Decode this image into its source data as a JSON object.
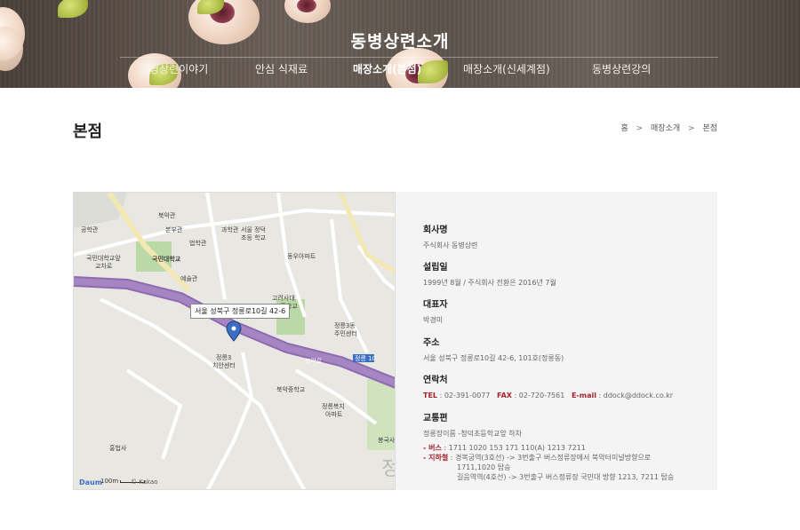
{
  "header": {
    "title": "동병상련소개",
    "nav": [
      {
        "label": "동병상련이야기",
        "active": false
      },
      {
        "label": "안심 식재료",
        "active": false
      },
      {
        "label": "매장소개(본점)",
        "active": true
      },
      {
        "label": "매장소개(신세계점)",
        "active": false
      },
      {
        "label": "동병상련강의",
        "active": false
      }
    ]
  },
  "page": {
    "title": "본점",
    "breadcrumb": [
      "홈",
      ">",
      "매장소개",
      ">",
      "본점"
    ]
  },
  "map": {
    "callout": "서울 성북구 정릉로10길 42-6",
    "labels": {
      "bukakgwan": "북악관",
      "bonbugwan": "본부관",
      "gongakgwan": "공학관",
      "beophakgwan": "법학관",
      "gwahakgwan": "과학관",
      "seoul_jeongdeok": "서울 정덕",
      "school_chodeung": "초등 학교",
      "kookmin_gate": "국민대학교앞",
      "gyochaero": "교차로",
      "kookmin_univ": "국민대학교",
      "yesulgwan": "예술관",
      "dongwoo_apt": "동우아파트",
      "korea_univ_attached": "고려사대",
      "hs": "고등학교",
      "jeongneung3_center": "정릉3동",
      "jumin_center": "주민센터",
      "jeongneung3": "정릉3",
      "chian_center": "치안센터",
      "bukak_middle": "북악중학교",
      "jeongneung_welfare": "정릉복지",
      "apt": "아파트",
      "hongbeopsa": "홍법사",
      "bongguksa": "봉국사",
      "road_label": "북악로",
      "road_sign": "정릉",
      "road_num": "10",
      "big_char": "정"
    },
    "logo": "Daum",
    "scale": "100m",
    "copyright": "© Kakao"
  },
  "info": {
    "company": {
      "label": "회사명",
      "value": "주식회사 동병상련"
    },
    "established": {
      "label": "설립일",
      "value": "1999년 8월 / 주식회사 전환은 2016년 7월"
    },
    "ceo": {
      "label": "대표자",
      "value": "박경미"
    },
    "address": {
      "label": "주소",
      "value": "서울 성북구 정릉로10길 42-6, 101호(정릉동)"
    },
    "contact": {
      "label": "연락처",
      "tel_label": "TEL",
      "tel": " : 02-391-0077",
      "fax_label": "FAX",
      "fax": " : 02-720-7561",
      "email_label": "E-mail",
      "email": " : ddock@ddock.co.kr"
    },
    "transport": {
      "label": "교통편",
      "stop": "정릉장이름 -청덕초등학교앞 하차",
      "bus_prefix": "- ",
      "bus_label": "버스",
      "bus": " : 1711 1020 153 171 110(A) 1213 7211",
      "subway_prefix": "- ",
      "subway_label": "지하철",
      "subway_line1": " : 경복궁역(3호선) -> 3번출구 버스정류장에서 북악터미널방향으로",
      "subway_line2": "1711,1020 탑승",
      "subway_line3": "길음역역(4호선) -> 3번출구 버스정류장 국민대 방향 1213, 7211 탑승"
    }
  },
  "colors": {
    "accent": "#a2252d",
    "panel": "#f4f4f4",
    "road": "#8e6bb0"
  }
}
